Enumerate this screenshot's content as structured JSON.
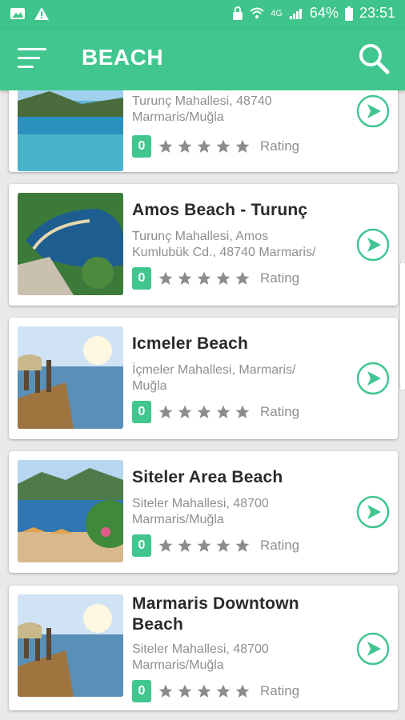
{
  "status_bar": {
    "battery": "64%",
    "time": "23:51",
    "network": "4G"
  },
  "app_bar": {
    "title": "BEACH"
  },
  "items": [
    {
      "name": "",
      "address_line1": "Turunç Mahallesi, 48740",
      "address_line2": "Marmaris/Muğla",
      "rating_count": "0",
      "rating_label": "Rating"
    },
    {
      "name": "Amos Beach - Turunç",
      "address_line1": "Turunç Mahallesi, Amos",
      "address_line2": "Kumlubük Cd., 48740 Marmaris/",
      "rating_count": "0",
      "rating_label": "Rating"
    },
    {
      "name": "Icmeler Beach",
      "address_line1": "İçmeler Mahallesi, Marmaris/",
      "address_line2": "Muğla",
      "rating_count": "0",
      "rating_label": "Rating"
    },
    {
      "name": "Siteler Area Beach",
      "address_line1": "Siteler Mahallesi, 48700",
      "address_line2": "Marmaris/Muğla",
      "rating_count": "0",
      "rating_label": "Rating"
    },
    {
      "name_line1": "Marmaris Downtown",
      "name_line2": "Beach",
      "address_line1": "Siteler Mahallesi, 48700",
      "address_line2": "Marmaris/Muğla",
      "rating_count": "0",
      "rating_label": "Rating"
    }
  ],
  "icons": {
    "menu": "menu-icon",
    "search": "search-icon",
    "go": "arrow-right-circle-icon",
    "star": "star-icon"
  },
  "colors": {
    "accent": "#41c690",
    "star": "#8c8c8c"
  }
}
